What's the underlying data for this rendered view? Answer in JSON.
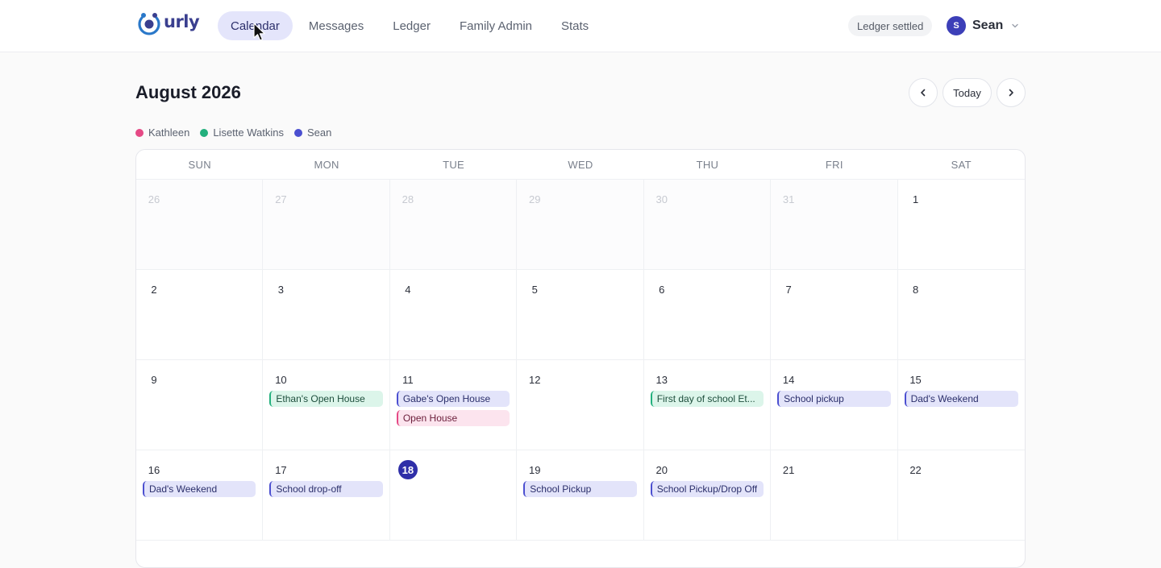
{
  "app": {
    "logo_text": "urly"
  },
  "nav": {
    "items": [
      {
        "label": "Calendar",
        "active": true
      },
      {
        "label": "Messages",
        "active": false
      },
      {
        "label": "Ledger",
        "active": false
      },
      {
        "label": "Family Admin",
        "active": false
      },
      {
        "label": "Stats",
        "active": false
      }
    ]
  },
  "header": {
    "status_badge": "Ledger settled",
    "user": {
      "initial": "S",
      "name": "Sean"
    }
  },
  "toolbar": {
    "month_title": "August 2026",
    "prev_icon": "chevron-left-icon",
    "today_label": "Today",
    "next_icon": "chevron-right-icon"
  },
  "legend": [
    {
      "name": "Kathleen",
      "color": "#e54985"
    },
    {
      "name": "Lisette Watkins",
      "color": "#23b07d"
    },
    {
      "name": "Sean",
      "color": "#4b4fd0"
    }
  ],
  "calendar": {
    "weekdays": [
      "SUN",
      "MON",
      "TUE",
      "WED",
      "THU",
      "FRI",
      "SAT"
    ],
    "weeks": [
      [
        {
          "day": "26",
          "outside": true,
          "events": []
        },
        {
          "day": "27",
          "outside": true,
          "events": []
        },
        {
          "day": "28",
          "outside": true,
          "events": []
        },
        {
          "day": "29",
          "outside": true,
          "events": []
        },
        {
          "day": "30",
          "outside": true,
          "events": []
        },
        {
          "day": "31",
          "outside": true,
          "events": []
        },
        {
          "day": "1",
          "outside": false,
          "events": []
        }
      ],
      [
        {
          "day": "2",
          "outside": false,
          "events": []
        },
        {
          "day": "3",
          "outside": false,
          "events": []
        },
        {
          "day": "4",
          "outside": false,
          "events": []
        },
        {
          "day": "5",
          "outside": false,
          "events": []
        },
        {
          "day": "6",
          "outside": false,
          "events": []
        },
        {
          "day": "7",
          "outside": false,
          "events": []
        },
        {
          "day": "8",
          "outside": false,
          "events": []
        }
      ],
      [
        {
          "day": "9",
          "outside": false,
          "events": []
        },
        {
          "day": "10",
          "outside": false,
          "events": [
            {
              "title": "Ethan's Open House",
              "owner": "lisette"
            }
          ]
        },
        {
          "day": "11",
          "outside": false,
          "events": [
            {
              "title": "Gabe's Open House",
              "owner": "sean"
            },
            {
              "title": "Open House",
              "owner": "kathleen"
            }
          ]
        },
        {
          "day": "12",
          "outside": false,
          "events": []
        },
        {
          "day": "13",
          "outside": false,
          "events": [
            {
              "title": "First day of school Et...",
              "owner": "lisette"
            }
          ]
        },
        {
          "day": "14",
          "outside": false,
          "events": [
            {
              "title": "School pickup",
              "owner": "sean"
            }
          ]
        },
        {
          "day": "15",
          "outside": false,
          "events": [
            {
              "title": "Dad's Weekend",
              "owner": "sean"
            }
          ]
        }
      ],
      [
        {
          "day": "16",
          "outside": false,
          "events": [
            {
              "title": "Dad's Weekend",
              "owner": "sean"
            }
          ]
        },
        {
          "day": "17",
          "outside": false,
          "events": [
            {
              "title": "School drop-off",
              "owner": "sean"
            }
          ]
        },
        {
          "day": "18",
          "outside": false,
          "today": true,
          "events": []
        },
        {
          "day": "19",
          "outside": false,
          "events": [
            {
              "title": "School Pickup",
              "owner": "sean"
            }
          ]
        },
        {
          "day": "20",
          "outside": false,
          "events": [
            {
              "title": "School Pickup/Drop Off",
              "owner": "sean"
            }
          ]
        },
        {
          "day": "21",
          "outside": false,
          "events": []
        },
        {
          "day": "22",
          "outside": false,
          "events": []
        }
      ]
    ]
  }
}
